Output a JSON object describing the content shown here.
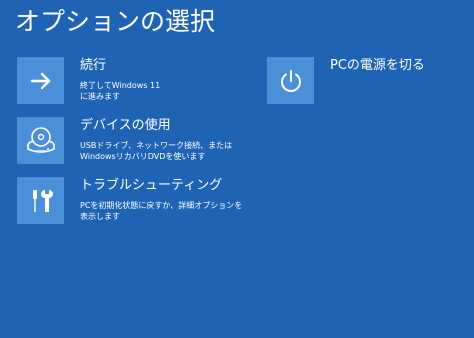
{
  "page": {
    "title": "オプションの選択"
  },
  "options": [
    {
      "title": "続行",
      "description": "終了してWindows 11\nに進みます",
      "icon": "arrow-right-icon"
    },
    {
      "title": "デバイスの使用",
      "description": "USBドライブ、ネットワーク接続、または\nWindowsリカバリDVDを使います",
      "icon": "disc-drive-icon"
    },
    {
      "title": "トラブルシューティング",
      "description": "PCを初期化状態に戻すか、詳細オプションを\n表示します",
      "icon": "tools-icon"
    },
    {
      "title": "PCの電源を切る",
      "icon": "power-icon"
    }
  ],
  "colors": {
    "background": "#1f64b4",
    "tile": "#4a90d9",
    "text": "#ffffff"
  }
}
